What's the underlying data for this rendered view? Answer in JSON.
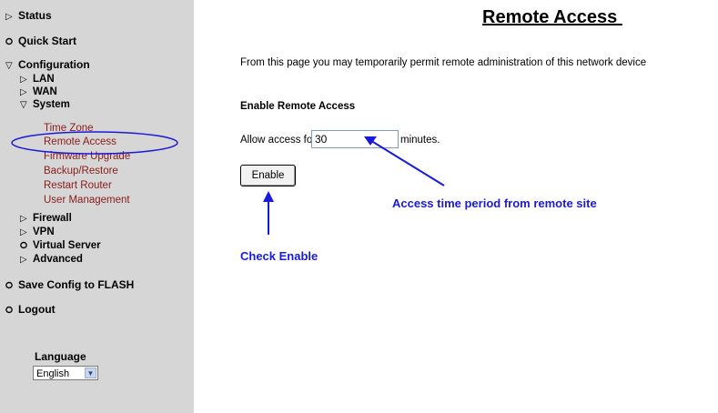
{
  "sidebar": {
    "status": "Status",
    "quick_start": "Quick Start",
    "configuration": "Configuration",
    "lan": "LAN",
    "wan": "WAN",
    "system": "System",
    "system_items": [
      "Time Zone",
      "Remote Access",
      "Firmware Upgrade",
      "Backup/Restore",
      "Restart Router",
      "User Management"
    ],
    "firewall": "Firewall",
    "vpn": "VPN",
    "virtual_server": "Virtual Server",
    "advanced": "Advanced",
    "save_config": "Save Config to FLASH",
    "logout": "Logout",
    "language_label": "Language",
    "language_value": "English"
  },
  "main": {
    "title": "Remote Access ",
    "description": "From this page you may temporarily permit remote administration of this network device",
    "section_heading": "Enable Remote Access",
    "allow_label": "Allow access for:",
    "minutes_value": "30",
    "minutes_unit": "minutes.",
    "enable_button": "Enable"
  },
  "annotations": {
    "access_time": "Access time period from remote site",
    "check_enable": "Check Enable"
  },
  "colors": {
    "sidebar_bg": "#d6d6d6",
    "submenu_link": "#8b1a1a",
    "annotation": "#1a1adb"
  }
}
